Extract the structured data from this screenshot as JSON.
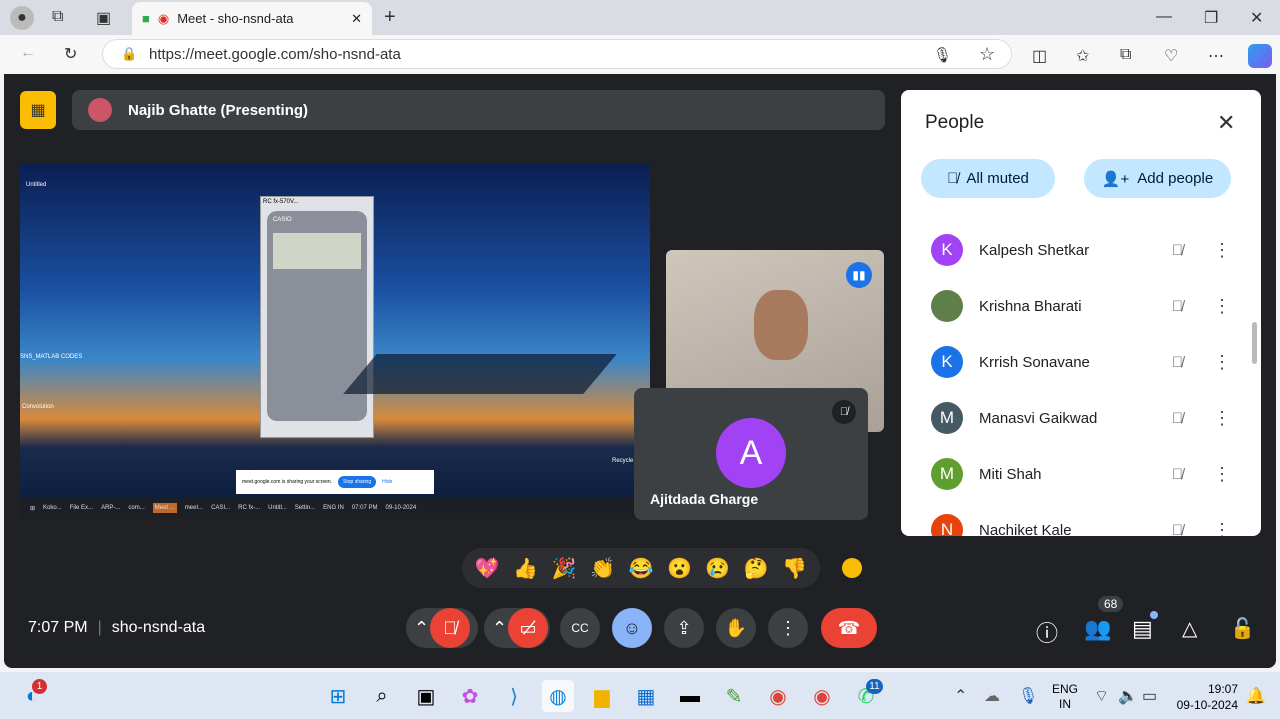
{
  "browser": {
    "tab_title": "Meet - sho-nsnd-ata",
    "url": "https://meet.google.com/sho-nsnd-ata"
  },
  "meet": {
    "presenter": "Najib Ghatte (Presenting)",
    "shared_screen": {
      "desktop_icons": [
        "Untitled",
        "SNS_MATLAB CODES",
        "Convolution",
        "Recycle Bin"
      ],
      "calc_title": "RC fx-570V...",
      "calc_brand": "CASIO",
      "share_notice": "meet.google.com is sharing your screen.",
      "stop_sharing": "Stop sharing",
      "hide": "Hide",
      "taskbar_items": [
        "Koko...",
        "File Ex...",
        "ARP-...",
        "com...",
        "Meet ...",
        "meet...",
        "CASI...",
        "RC fx-...",
        "Untitl...",
        "Settin..."
      ],
      "lang": "ENG IN",
      "time": "07:07 PM",
      "date": "09-10-2024"
    },
    "tile_name": "Ajitdada Gharge",
    "tile_initial": "A",
    "time": "7:07 PM",
    "meeting_code": "sho-nsnd-ata",
    "reactions": [
      "💖",
      "👍",
      "🎉",
      "👏",
      "😂",
      "😮",
      "😢",
      "🤔",
      "👎"
    ],
    "participant_count": "68"
  },
  "people": {
    "title": "People",
    "all_muted": "All muted",
    "add_people": "Add people",
    "list": [
      {
        "initial": "K",
        "name": "Kalpesh Shetkar",
        "color": "#a142f4"
      },
      {
        "initial": "",
        "name": "Krishna Bharati",
        "color": "#5f7f4a"
      },
      {
        "initial": "K",
        "name": "Krrish Sonavane",
        "color": "#1a73e8"
      },
      {
        "initial": "M",
        "name": "Manasvi Gaikwad",
        "color": "#455a64"
      },
      {
        "initial": "M",
        "name": "Miti Shah",
        "color": "#5f9e2f"
      },
      {
        "initial": "N",
        "name": "Nachiket Kale",
        "color": "#e8430a"
      }
    ]
  },
  "taskbar": {
    "lang1": "ENG",
    "lang2": "IN",
    "time": "19:07",
    "date": "09-10-2024",
    "badge_left": "1",
    "badge_whatsapp": "11"
  }
}
